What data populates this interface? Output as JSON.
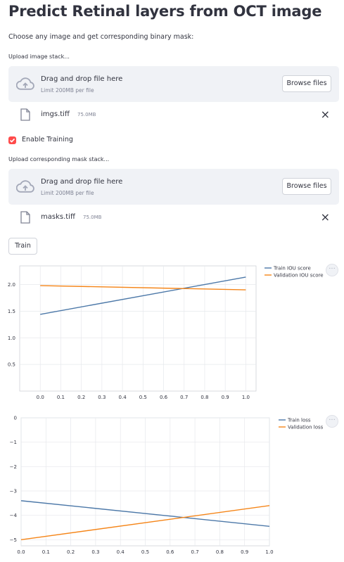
{
  "page": {
    "title": "Predict Retinal layers from OCT image",
    "subtitle": "Choose any image and get corresponding binary mask:"
  },
  "upload_images": {
    "label": "Upload image stack...",
    "drop_text": "Drag and drop file here",
    "limit_text": "Limit 200MB per file",
    "browse_label": "Browse files",
    "file": {
      "name": "imgs.tiff",
      "size": "75.0MB"
    }
  },
  "training": {
    "checkbox_label": "Enable Training",
    "checked": true
  },
  "upload_masks": {
    "label": "Upload corresponding mask stack...",
    "drop_text": "Drag and drop file here",
    "limit_text": "Limit 200MB per file",
    "browse_label": "Browse files",
    "file": {
      "name": "masks.tiff",
      "size": "75.0MB"
    }
  },
  "train_button": {
    "label": "Train"
  },
  "icons": {
    "upload": "cloud-upload-icon",
    "file": "file-icon",
    "remove": "close-icon",
    "check": "check-icon",
    "menu": "more-horizontal-icon"
  },
  "colors": {
    "accent": "#ff4b4b",
    "series_blue": "#4c78a8",
    "series_orange": "#f58518",
    "panel_bg": "#f0f2f6"
  },
  "chart_data": [
    {
      "type": "line",
      "title": "",
      "xlabel": "",
      "ylabel": "",
      "x": [
        0,
        1
      ],
      "xlim": [
        -0.1,
        1.05
      ],
      "ylim": [
        0,
        2.35
      ],
      "xticks": [
        "0.0",
        "0.1",
        "0.2",
        "0.3",
        "0.4",
        "0.5",
        "0.6",
        "0.7",
        "0.8",
        "0.9",
        "1.0"
      ],
      "xtick_values": [
        0,
        0.1,
        0.2,
        0.3,
        0.4,
        0.5,
        0.6,
        0.7,
        0.8,
        0.9,
        1.0
      ],
      "yticks": [
        "0.5",
        "1.0",
        "1.5",
        "2.0"
      ],
      "ytick_values": [
        0.5,
        1.0,
        1.5,
        2.0
      ],
      "grid": true,
      "legend_position": "top-right",
      "series": [
        {
          "name": "Train IOU score",
          "color": "#4c78a8",
          "values": [
            1.44,
            2.14
          ]
        },
        {
          "name": "Validation IOU score",
          "color": "#f58518",
          "values": [
            1.98,
            1.9
          ]
        }
      ]
    },
    {
      "type": "line",
      "title": "",
      "xlabel": "",
      "ylabel": "",
      "x": [
        0,
        1
      ],
      "xlim": [
        0,
        1
      ],
      "ylim": [
        -5.25,
        0
      ],
      "xticks": [
        "0.0",
        "0.1",
        "0.2",
        "0.3",
        "0.4",
        "0.5",
        "0.6",
        "0.7",
        "0.8",
        "0.9",
        "1.0"
      ],
      "xtick_values": [
        0,
        0.1,
        0.2,
        0.3,
        0.4,
        0.5,
        0.6,
        0.7,
        0.8,
        0.9,
        1.0
      ],
      "yticks": [
        "0",
        "−1",
        "−2",
        "−3",
        "−4",
        "−5"
      ],
      "ytick_values": [
        0,
        -1,
        -2,
        -3,
        -4,
        -5
      ],
      "grid": true,
      "legend_position": "top-right",
      "series": [
        {
          "name": "Train loss",
          "color": "#4c78a8",
          "values": [
            -3.4,
            -4.45
          ]
        },
        {
          "name": "Validation loss",
          "color": "#f58518",
          "values": [
            -5.0,
            -3.6
          ]
        }
      ]
    }
  ]
}
